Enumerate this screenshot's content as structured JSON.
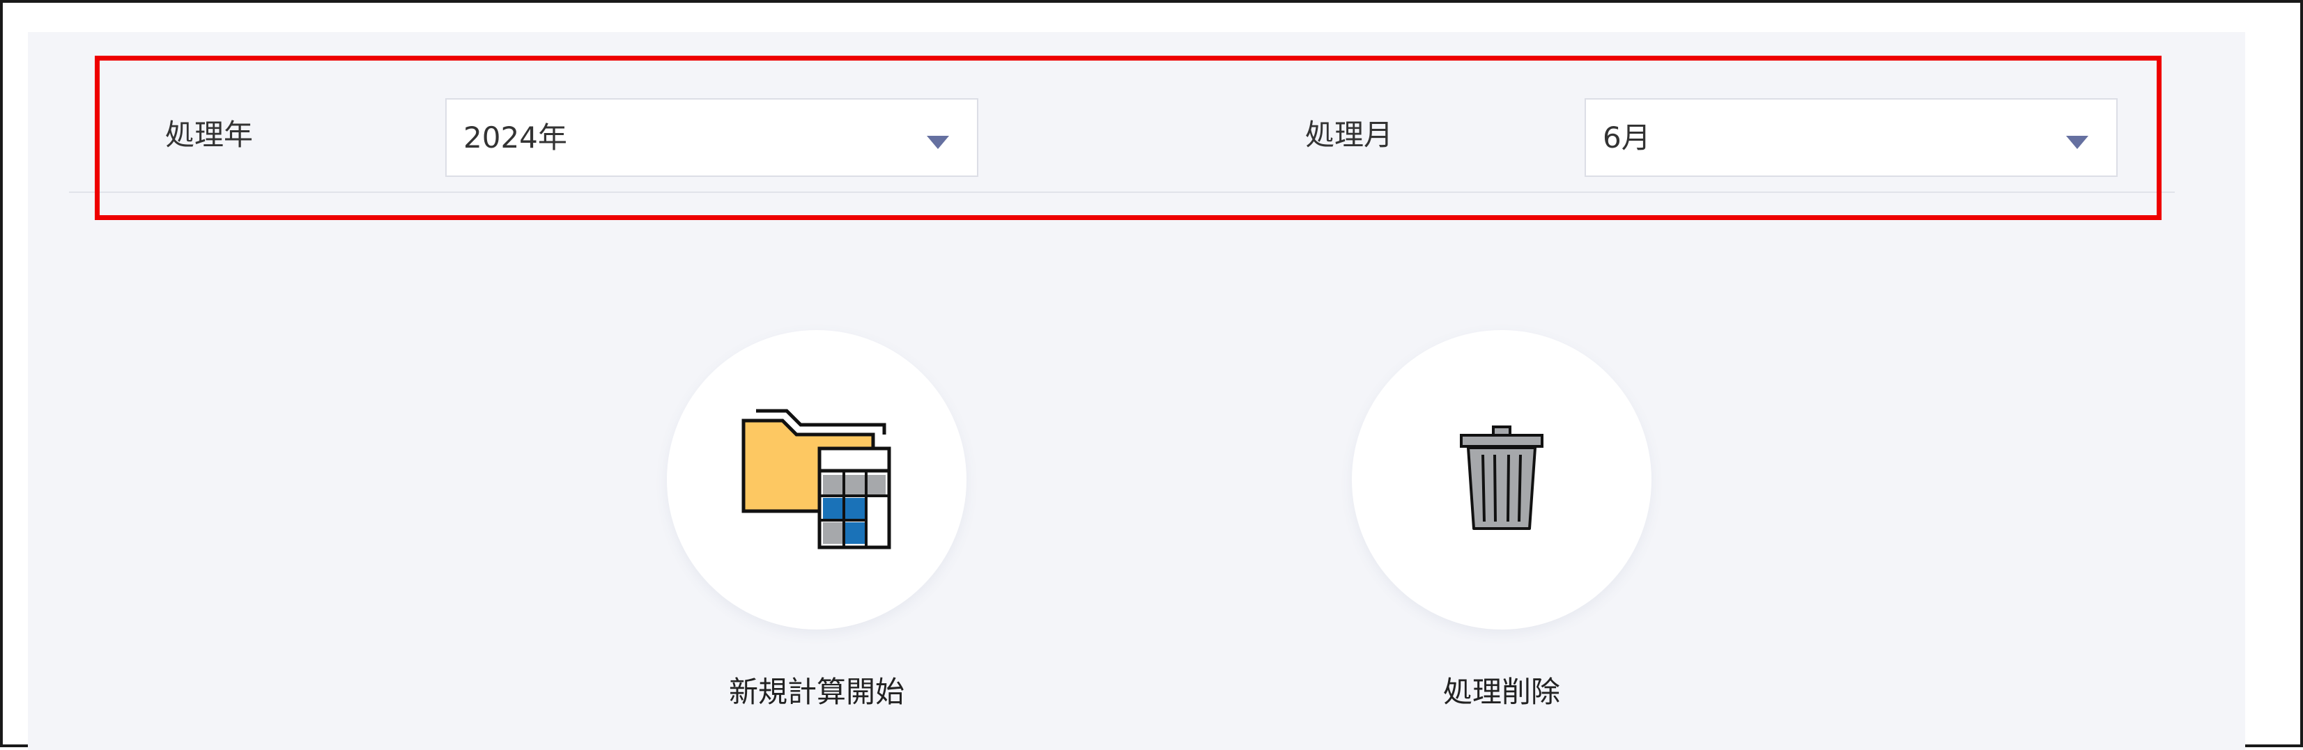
{
  "filters": {
    "year_label": "処理年",
    "year_value": "2024年",
    "month_label": "処理月",
    "month_value": "6月"
  },
  "actions": {
    "new_calc_label": "新規計算開始",
    "delete_label": "処理削除"
  },
  "icons": {
    "dropdown": "caret-down-icon",
    "new_calc": "folder-calculator-icon",
    "delete": "trash-can-icon"
  },
  "colors": {
    "highlight": "#ee0000",
    "panel_bg": "#f4f5f9",
    "caret": "#6570a0",
    "folder": "#fdc862",
    "calc_blue": "#1a72b8",
    "calc_gray": "#a6a8ab"
  }
}
